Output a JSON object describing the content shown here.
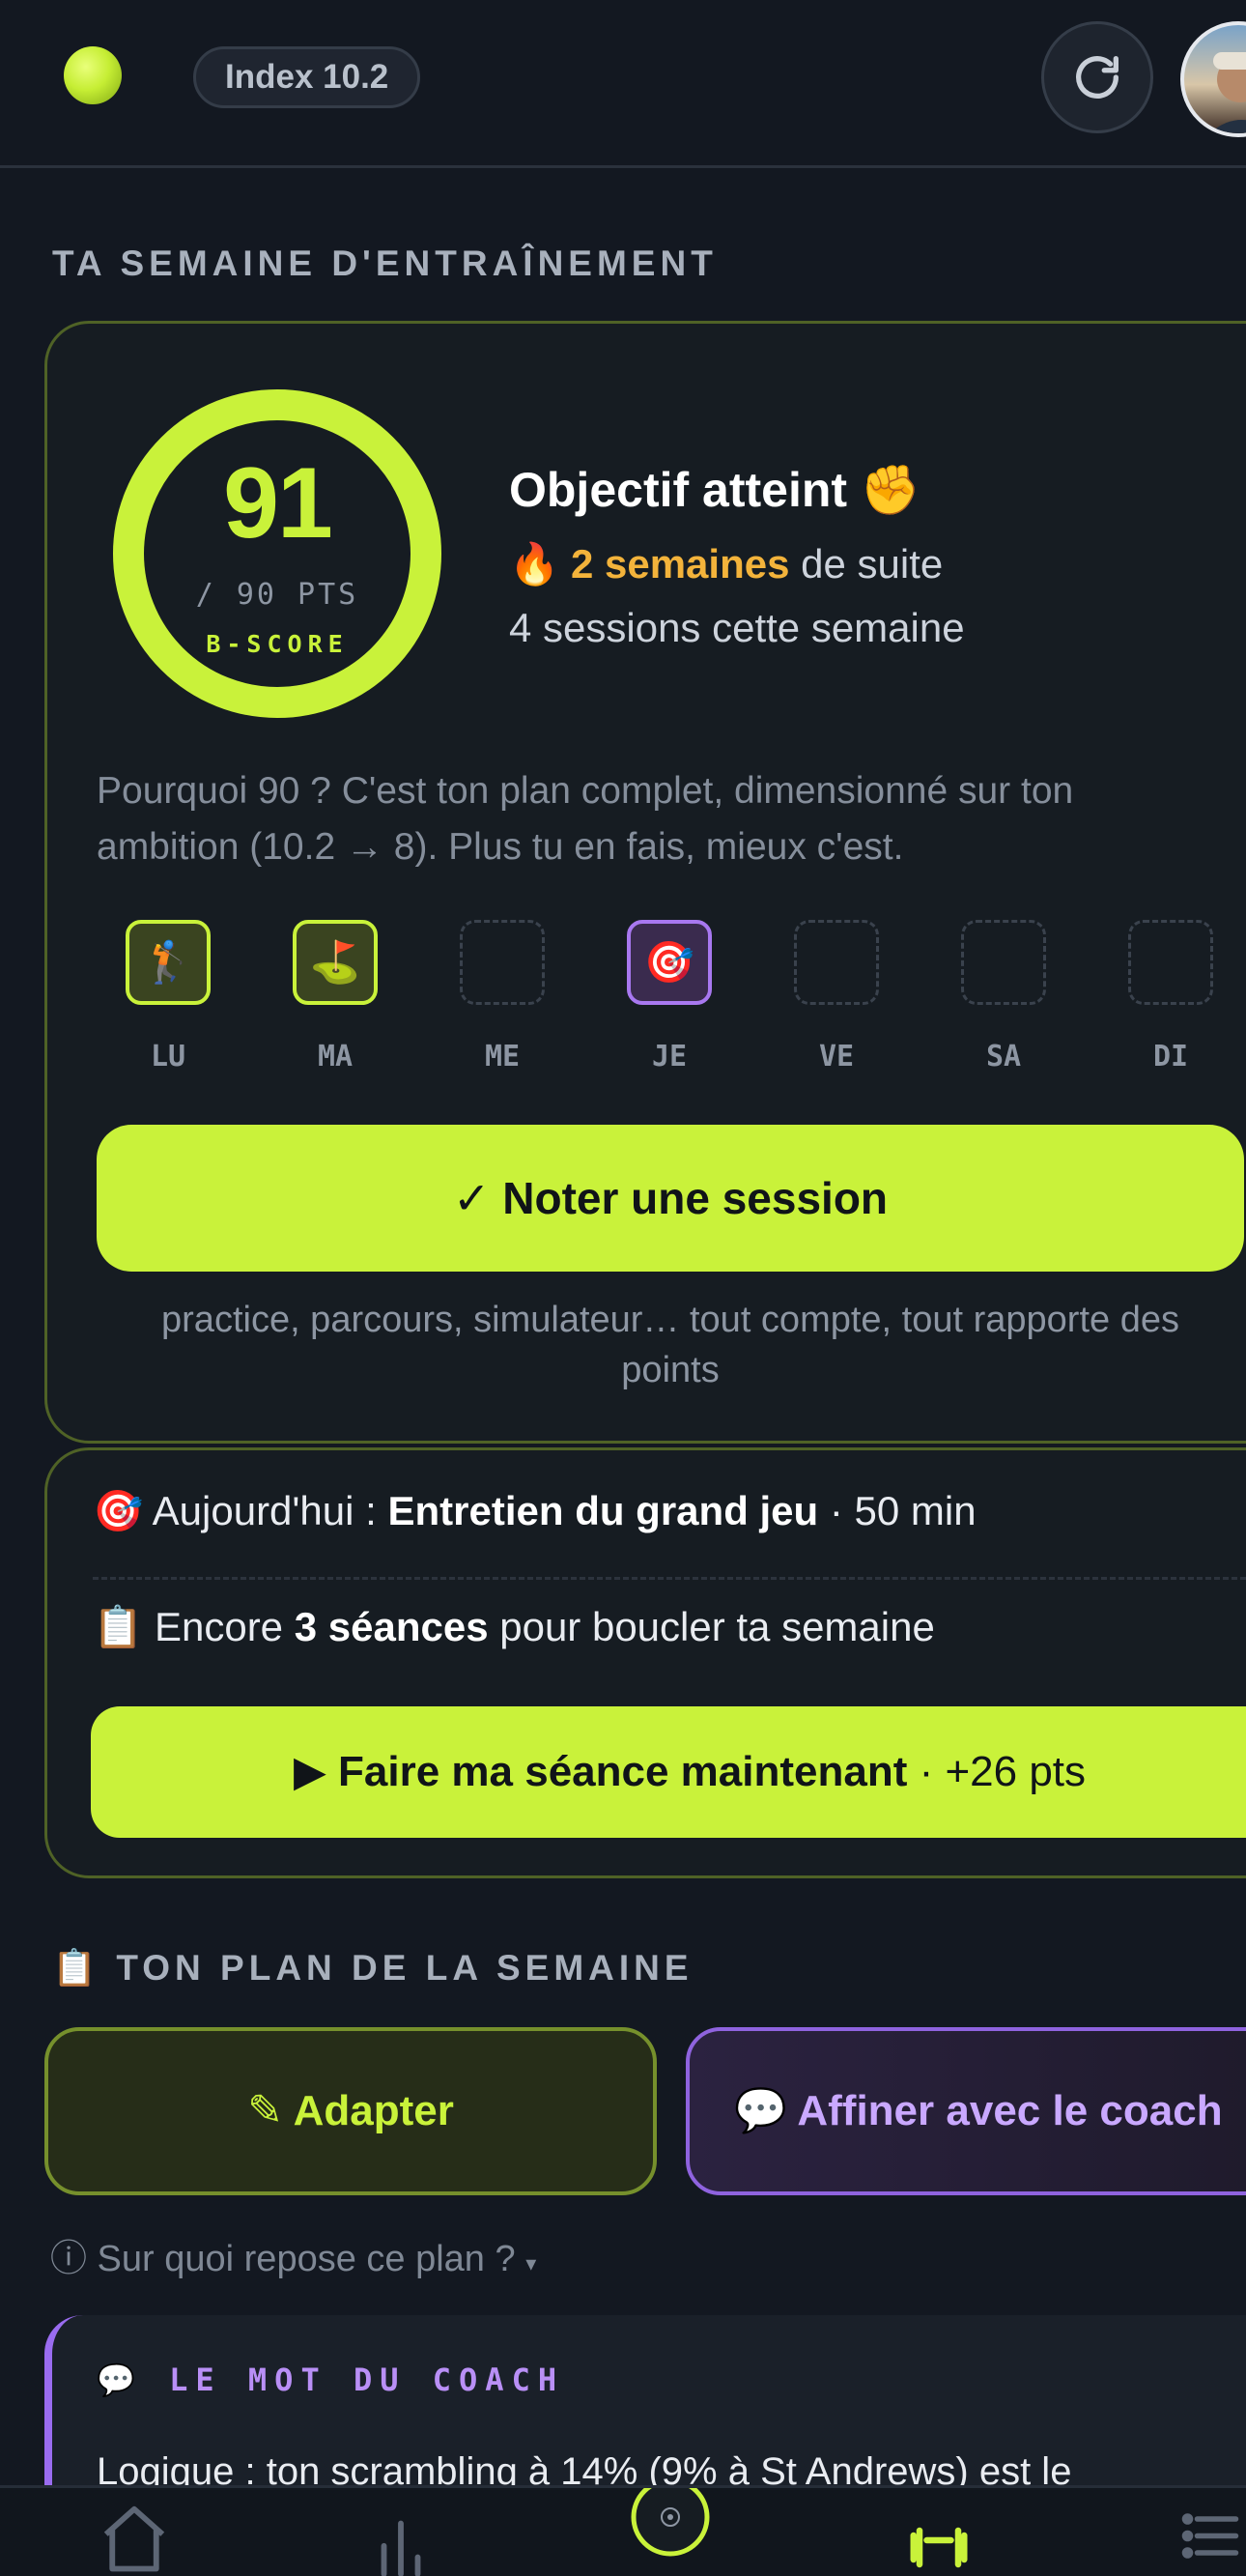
{
  "header": {
    "index_label": "Index 10.2"
  },
  "week": {
    "section_title": "TA SEMAINE D'ENTRAÎNEMENT",
    "score": "91",
    "score_max": "/ 90 PTS",
    "score_label": "B-SCORE",
    "score_fraction": 1.0,
    "goal_title": "Objectif atteint ✊",
    "streak_emoji": "🔥",
    "streak_highlight": "2 semaines",
    "streak_rest": " de suite",
    "sessions_text": "4 sessions cette semaine",
    "why_text": "Pourquoi 90 ? C'est ton plan complet, dimensionné sur ton ambition (10.2 → 8). Plus tu en fais, mieux c'est.",
    "days": [
      {
        "label": "LU",
        "state": "done",
        "emoji": "🏌️"
      },
      {
        "label": "MA",
        "state": "done",
        "emoji": "⛳"
      },
      {
        "label": "ME",
        "state": "empty",
        "emoji": ""
      },
      {
        "label": "JE",
        "state": "coach",
        "emoji": "🎯"
      },
      {
        "label": "VE",
        "state": "empty",
        "emoji": ""
      },
      {
        "label": "SA",
        "state": "empty",
        "emoji": ""
      },
      {
        "label": "DI",
        "state": "empty",
        "emoji": ""
      }
    ],
    "note_button": "✓ Noter une session",
    "note_hint": "practice, parcours, simulateur… tout compte, tout rapporte des points"
  },
  "today": {
    "emoji": "🎯",
    "prefix": " Aujourd'hui : ",
    "session_name": "Entretien du grand jeu",
    "duration": " · 50 min",
    "remain_emoji": "📋",
    "remain_prefix": " Encore ",
    "remain_count": "3 séances",
    "remain_suffix": " pour boucler ta semaine",
    "do_button": "▶ Faire ma séance maintenant",
    "do_button_pts": " · +26 pts"
  },
  "plan": {
    "section_title": "📋 TON PLAN DE LA SEMAINE",
    "adapt_button": "✎ Adapter",
    "refine_button": "💬 Affiner avec le coach",
    "basis_text": "ⓘ Sur quoi repose ce plan ?",
    "basis_caret": "▾"
  },
  "coach": {
    "title_emoji": "💬",
    "title": "LE MOT DU COACH",
    "text": "Logique : ton scrambling à 14% (9% à St Andrews) est le"
  },
  "nav": {
    "icons": [
      "home-icon",
      "stats-icon",
      "target-icon",
      "training-icon",
      "list-icon"
    ],
    "active": "training-icon"
  },
  "colors": {
    "accent": "#c9f23a",
    "coach": "#9a6cf0",
    "streak": "#f3b33b",
    "background": "#131821"
  }
}
